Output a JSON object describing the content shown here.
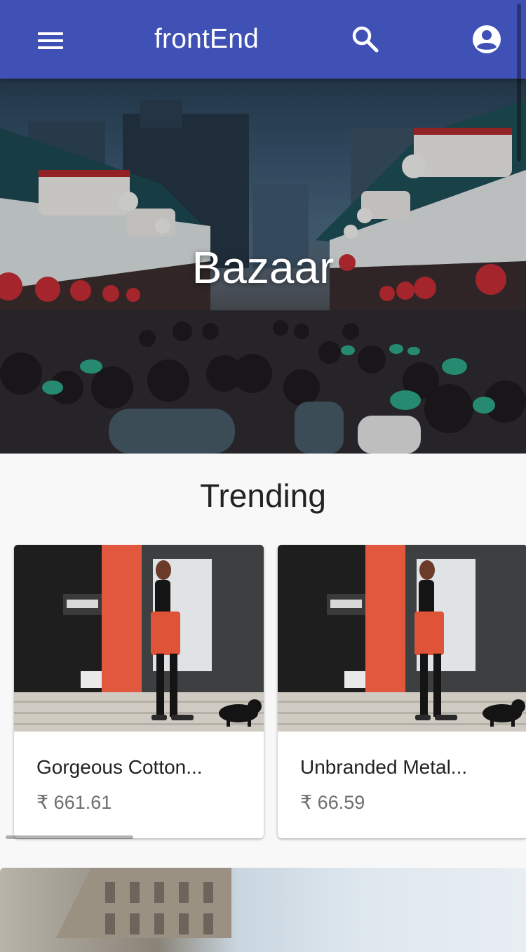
{
  "app_bar": {
    "title": "frontEnd",
    "background": "#3f51b5",
    "icons": {
      "menu": "menu-icon",
      "search": "search-icon",
      "account": "account-circle-icon"
    }
  },
  "hero": {
    "title": "Bazaar",
    "image": "crowded-market-street-photo"
  },
  "trending": {
    "title": "Trending",
    "products": [
      {
        "name": "Gorgeous Cotton...",
        "price": "₹ 661.61",
        "image": "woman-with-dog-photo"
      },
      {
        "name": "Unbranded Metal...",
        "price": "₹ 66.59",
        "image": "woman-with-dog-photo"
      }
    ]
  },
  "next_section": {
    "image": "building-photo"
  }
}
